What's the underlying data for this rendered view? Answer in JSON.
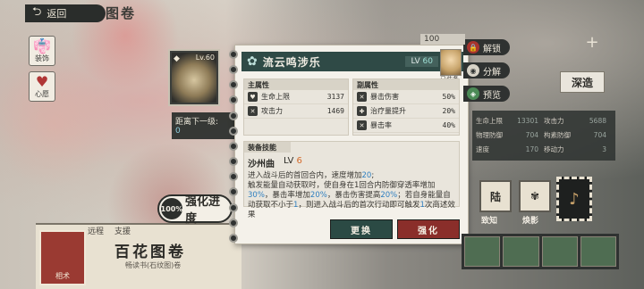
{
  "header": {
    "back_label": "返回",
    "title": "图卷"
  },
  "side_icons": [
    {
      "label": "装饰",
      "icon": "costume-icon"
    },
    {
      "label": "心愿",
      "icon": "heart-icon"
    }
  ],
  "distance": {
    "label": "距离下一级:",
    "value": "0"
  },
  "card": {
    "level": "Lv.60",
    "mark": "◆"
  },
  "enhance": {
    "percent": "100",
    "percent_sign": "%",
    "label": "强化进度"
  },
  "item": {
    "name": "流云鸣涉乐",
    "level_prefix": "LV",
    "level": "60",
    "owner_tag": "已装备"
  },
  "main_attrs": {
    "title": "主属性",
    "rows": [
      {
        "name": "生命上限",
        "value": "3137"
      },
      {
        "name": "攻击力",
        "value": "1469"
      }
    ]
  },
  "sub_attrs": {
    "title": "副属性",
    "rows": [
      {
        "name": "暴击伤害",
        "value": "50%"
      },
      {
        "name": "治疗量提升",
        "value": "20%"
      },
      {
        "name": "暴击率",
        "value": "40%"
      }
    ]
  },
  "skill": {
    "title": "装备技能",
    "name": "沙州曲",
    "level_prefix": "LV",
    "level": "6",
    "desc_1": "进入战斗后的首回合内，速度增加",
    "desc_1_hl": "20",
    "desc_1_end": ";",
    "desc_2": "触发能量自动获取时，使自身在1回合内防御穿透率增加",
    "desc_2_hl": "30%",
    "desc_3": "，暴击率增加",
    "desc_3_hl": "20%",
    "desc_4": "，暴击伤害提高",
    "desc_4_hl": "20%",
    "desc_5": "；若自身能量自动获取不小于",
    "desc_5_hl": "1",
    "desc_6": "，则进入战斗后的首次行动即可触发",
    "desc_6_hl": "1",
    "desc_6_end": "次商述效果"
  },
  "buttons": {
    "swap": "更换",
    "enhance": "强化"
  },
  "actions": {
    "unlock": "解锁",
    "decompose": "分解",
    "preview": "预览"
  },
  "right": {
    "badge": "100",
    "deep": "深造",
    "stats": [
      {
        "l": "生命上限",
        "n": "13301",
        "l2": "攻击力",
        "n2": "5688"
      },
      {
        "l": "物理防御",
        "n": "704",
        "l2": "构素防御",
        "n2": "704"
      },
      {
        "l": "速度",
        "n": "170",
        "l2": "移动力",
        "n2": "3"
      }
    ],
    "tile1": "陆",
    "tile1_label": "致知",
    "tile2_label": "焕影"
  },
  "poster": {
    "tabs": [
      "远程",
      "支援"
    ],
    "title": "百花图卷",
    "subtitle": "畅读书(石纹图)卷",
    "seal": "相术"
  }
}
